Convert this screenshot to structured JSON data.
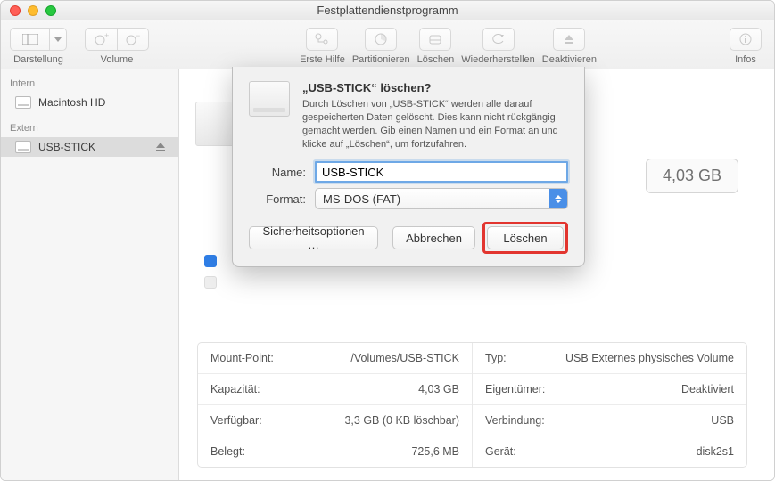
{
  "window": {
    "title": "Festplattendienstprogramm"
  },
  "toolbar": {
    "view_label": "Darstellung",
    "volume_label": "Volume",
    "firstaid_label": "Erste Hilfe",
    "partition_label": "Partitionieren",
    "erase_label": "Löschen",
    "restore_label": "Wiederherstellen",
    "disable_label": "Deaktivieren",
    "info_label": "Infos"
  },
  "sidebar": {
    "internal_header": "Intern",
    "external_header": "Extern",
    "internal": [
      {
        "label": "Macintosh HD"
      }
    ],
    "external": [
      {
        "label": "USB-STICK"
      }
    ]
  },
  "content": {
    "capacity_badge": "4,03 GB"
  },
  "info": {
    "left": [
      {
        "key": "Mount-Point:",
        "val": "/Volumes/USB-STICK"
      },
      {
        "key": "Kapazität:",
        "val": "4,03 GB"
      },
      {
        "key": "Verfügbar:",
        "val": "3,3 GB (0 KB löschbar)"
      },
      {
        "key": "Belegt:",
        "val": "725,6 MB"
      }
    ],
    "right": [
      {
        "key": "Typ:",
        "val": "USB Externes physisches Volume"
      },
      {
        "key": "Eigentümer:",
        "val": "Deaktiviert"
      },
      {
        "key": "Verbindung:",
        "val": "USB"
      },
      {
        "key": "Gerät:",
        "val": "disk2s1"
      }
    ]
  },
  "sheet": {
    "title": "„USB-STICK“ löschen?",
    "text": "Durch Löschen von „USB-STICK“ werden alle darauf gespeicherten Daten gelöscht. Dies kann nicht rückgängig gemacht werden. Gib einen Namen und ein Format an und klicke auf „Löschen“, um fortzufahren.",
    "name_label": "Name:",
    "name_value": "USB-STICK",
    "format_label": "Format:",
    "format_value": "MS-DOS (FAT)",
    "security_btn": "Sicherheitsoptionen …",
    "cancel_btn": "Abbrechen",
    "erase_btn": "Löschen"
  }
}
